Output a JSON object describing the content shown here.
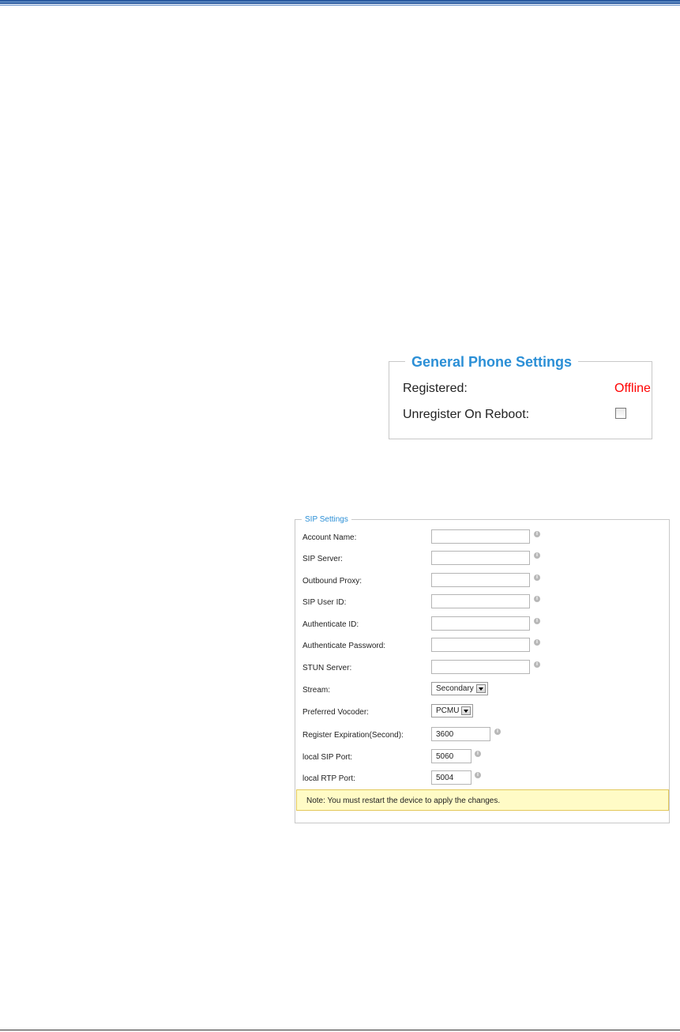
{
  "general_phone_settings": {
    "title": "General Phone Settings",
    "registered_label": "Registered:",
    "registered_status": "Offline",
    "status_color": "#ff0000",
    "unregister_label": "Unregister On Reboot:",
    "unregister_checked": false
  },
  "sip_settings": {
    "title": "SIP Settings",
    "account_name": {
      "label": "Account Name:",
      "value": ""
    },
    "sip_server": {
      "label": "SIP Server:",
      "value": ""
    },
    "outbound_proxy": {
      "label": "Outbound Proxy:",
      "value": ""
    },
    "sip_user_id": {
      "label": "SIP User ID:",
      "value": ""
    },
    "authenticate_id": {
      "label": "Authenticate ID:",
      "value": ""
    },
    "authenticate_password": {
      "label": "Authenticate Password:",
      "value": ""
    },
    "stun_server": {
      "label": "STUN Server:",
      "value": ""
    },
    "stream": {
      "label": "Stream:",
      "selected": "Secondary"
    },
    "preferred_vocoder": {
      "label": "Preferred Vocoder:",
      "selected": "PCMU"
    },
    "register_expiration": {
      "label": "Register Expiration(Second):",
      "value": "3600"
    },
    "local_sip_port": {
      "label": "local SIP Port:",
      "value": "5060"
    },
    "local_rtp_port": {
      "label": "local RTP Port:",
      "value": "5004"
    },
    "note": "Note: You must restart the device to apply the changes.",
    "info_icon": "info-icon"
  }
}
